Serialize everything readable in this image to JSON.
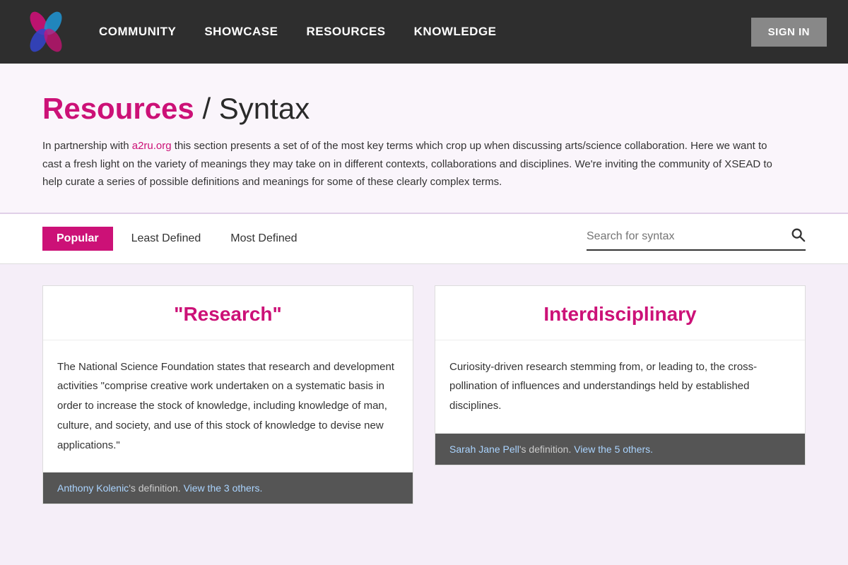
{
  "nav": {
    "links": [
      {
        "label": "COMMUNITY",
        "href": "#"
      },
      {
        "label": "SHOWCASE",
        "href": "#"
      },
      {
        "label": "RESOURCES",
        "href": "#"
      },
      {
        "label": "KNOWLEDGE",
        "href": "#"
      }
    ],
    "sign_in": "SIGN IN"
  },
  "hero": {
    "title_brand": "Resources",
    "title_sep": " / ",
    "title_rest": "Syntax",
    "description": "In partnership with a2ru.org this section presents a set of of the most key terms which crop up when discussing arts/science collaboration. Here we want to cast a fresh light on the variety of meanings they may take on in different contexts, collaborations and disciplines. We're inviting the community of XSEAD to help curate a series of possible definitions and meanings for some of these clearly complex terms.",
    "link_text": "a2ru.org"
  },
  "filter_bar": {
    "tab_popular": "Popular",
    "tab_least": "Least Defined",
    "tab_most": "Most Defined",
    "search_placeholder": "Search for syntax"
  },
  "cards": [
    {
      "id": "research",
      "title": "\"Research\"",
      "body": "The National Science Foundation states that research and development activities \"comprise creative work undertaken on a systematic basis in order to increase the stock of knowledge, including knowledge of man, culture, and society, and use of this stock of knowledge to devise new applications.\"",
      "footer_author": "Anthony Kolenic",
      "footer_text": "'s definition.",
      "footer_link": "View the 3 others."
    },
    {
      "id": "interdisciplinary",
      "title": "Interdisciplinary",
      "body": "Curiosity-driven research stemming from, or leading to, the cross-pollination of influences and understandings held by established disciplines.",
      "footer_author": "Sarah Jane Pell",
      "footer_text": "'s definition.",
      "footer_link": "View the 5 others."
    }
  ]
}
